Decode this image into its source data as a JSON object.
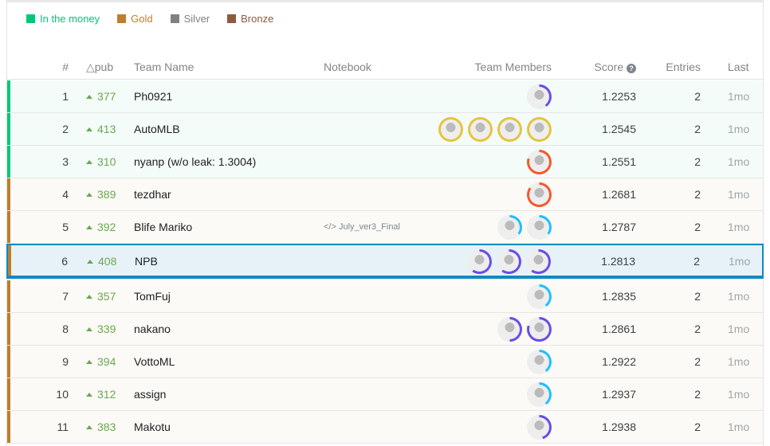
{
  "legend": [
    {
      "label": "In the money",
      "color": "#00c87a"
    },
    {
      "label": "Gold",
      "color": "#bd7f2c"
    },
    {
      "label": "Silver",
      "color": "#808080"
    },
    {
      "label": "Bronze",
      "color": "#8e5a3e"
    }
  ],
  "columns": {
    "rank": "#",
    "delta": "△pub",
    "team": "Team Name",
    "notebook": "Notebook",
    "members": "Team Members",
    "score": "Score",
    "entries": "Entries",
    "last": "Last"
  },
  "rows": [
    {
      "rank": "1",
      "delta": "377",
      "team": "Ph0921",
      "notebook": "",
      "members": [
        {
          "ring": "#6b4ce6",
          "fill": 0.4
        }
      ],
      "score": "1.2253",
      "entries": "2",
      "last": "1mo",
      "tier": "money",
      "selected": false
    },
    {
      "rank": "2",
      "delta": "413",
      "team": "AutoMLB",
      "notebook": "",
      "members": [
        {
          "ring": "#e6c440",
          "fill": 1
        },
        {
          "ring": "#e6c440",
          "fill": 1
        },
        {
          "ring": "#e6c440",
          "fill": 1
        },
        {
          "ring": "#e6c440",
          "fill": 1
        }
      ],
      "score": "1.2545",
      "entries": "2",
      "last": "1mo",
      "tier": "money",
      "selected": false
    },
    {
      "rank": "3",
      "delta": "310",
      "team": "nyanp (w/o leak: 1.3004)",
      "notebook": "",
      "members": [
        {
          "ring": "#f5582d",
          "fill": 0.8
        }
      ],
      "score": "1.2551",
      "entries": "2",
      "last": "1mo",
      "tier": "money",
      "selected": false
    },
    {
      "rank": "4",
      "delta": "389",
      "team": "tezdhar",
      "notebook": "",
      "members": [
        {
          "ring": "#f5582d",
          "fill": 0.85
        }
      ],
      "score": "1.2681",
      "entries": "2",
      "last": "1mo",
      "tier": "gold",
      "selected": false
    },
    {
      "rank": "5",
      "delta": "392",
      "team": "Blife Mariko",
      "notebook": "</> July_ver3_Final",
      "members": [
        {
          "ring": "#20beff",
          "fill": 0.35
        },
        {
          "ring": "#20beff",
          "fill": 0.35
        }
      ],
      "score": "1.2787",
      "entries": "2",
      "last": "1mo",
      "tier": "gold",
      "selected": false
    },
    {
      "rank": "6",
      "delta": "408",
      "team": "NPB",
      "notebook": "",
      "members": [
        {
          "ring": "#6b4ce6",
          "fill": 0.6
        },
        {
          "ring": "#6b4ce6",
          "fill": 0.6
        },
        {
          "ring": "#6b4ce6",
          "fill": 0.6
        }
      ],
      "score": "1.2813",
      "entries": "2",
      "last": "1mo",
      "tier": "gold",
      "selected": true
    },
    {
      "rank": "7",
      "delta": "357",
      "team": "TomFuj",
      "notebook": "",
      "members": [
        {
          "ring": "#20beff",
          "fill": 0.4
        }
      ],
      "score": "1.2835",
      "entries": "2",
      "last": "1mo",
      "tier": "gold",
      "selected": false
    },
    {
      "rank": "8",
      "delta": "339",
      "team": "nakano",
      "notebook": "",
      "members": [
        {
          "ring": "#6b4ce6",
          "fill": 0.5
        },
        {
          "ring": "#6b4ce6",
          "fill": 0.8
        }
      ],
      "score": "1.2861",
      "entries": "2",
      "last": "1mo",
      "tier": "gold",
      "selected": false
    },
    {
      "rank": "9",
      "delta": "394",
      "team": "VottoML",
      "notebook": "",
      "members": [
        {
          "ring": "#20beff",
          "fill": 0.4
        }
      ],
      "score": "1.2922",
      "entries": "2",
      "last": "1mo",
      "tier": "gold",
      "selected": false
    },
    {
      "rank": "10",
      "delta": "312",
      "team": "assign",
      "notebook": "",
      "members": [
        {
          "ring": "#20beff",
          "fill": 0.4
        }
      ],
      "score": "1.2937",
      "entries": "2",
      "last": "1mo",
      "tier": "gold",
      "selected": false
    },
    {
      "rank": "11",
      "delta": "383",
      "team": "Makotu",
      "notebook": "",
      "members": [
        {
          "ring": "#6b4ce6",
          "fill": 0.45
        }
      ],
      "score": "1.2938",
      "entries": "2",
      "last": "1mo",
      "tier": "gold",
      "selected": false
    }
  ],
  "tier_colors": {
    "money": {
      "bar": "#00c87a",
      "bg": "#f4fcf9"
    },
    "gold": {
      "bar": "#bd7f2c",
      "bg": "#fbfaf6"
    }
  }
}
